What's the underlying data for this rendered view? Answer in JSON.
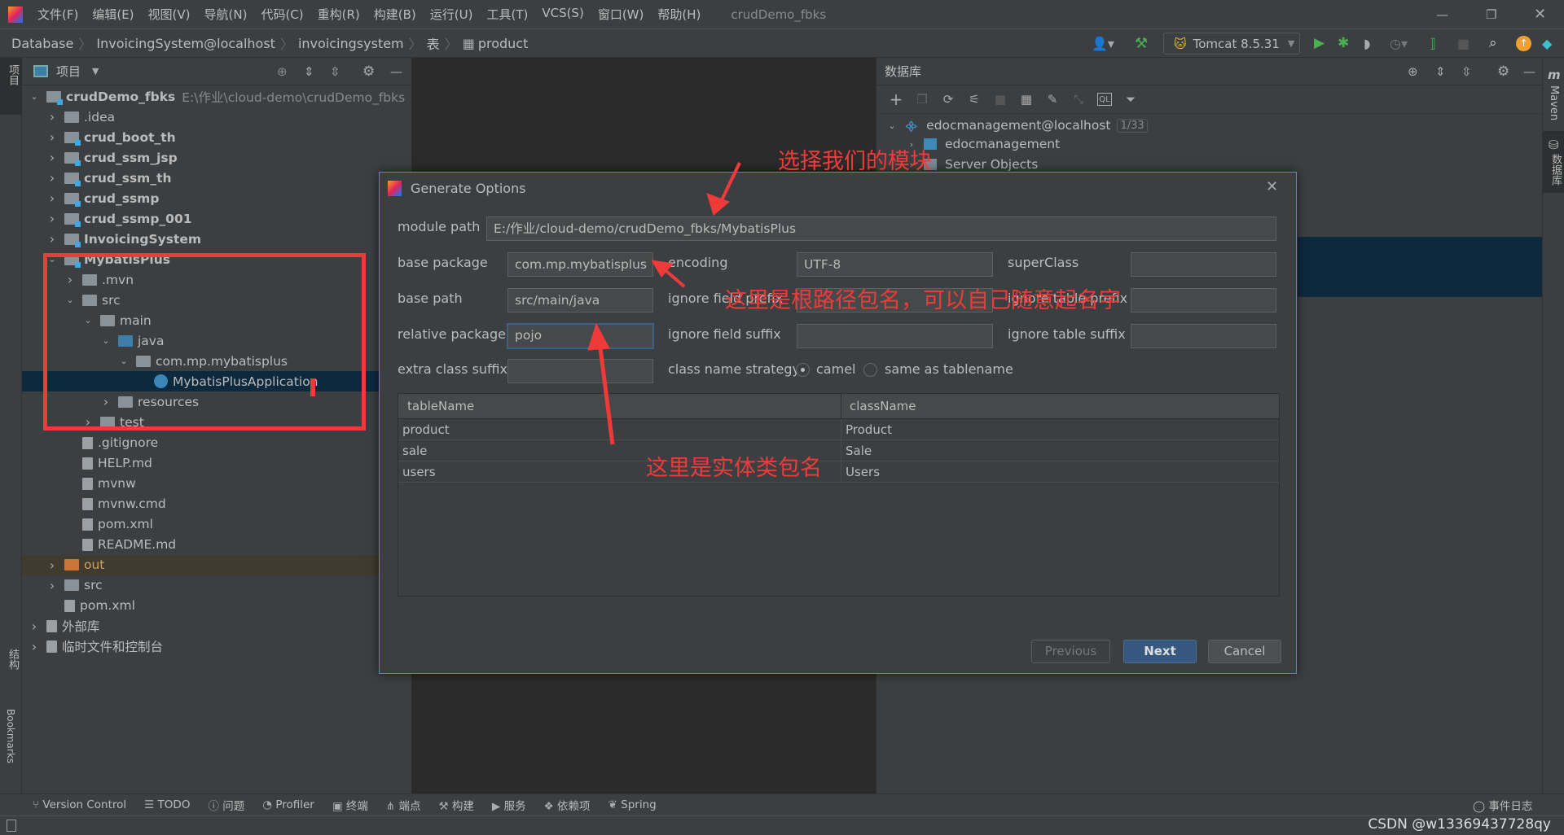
{
  "app": {
    "title": "crudDemo_fbks",
    "menu": [
      "文件(F)",
      "编辑(E)",
      "视图(V)",
      "导航(N)",
      "代码(C)",
      "重构(R)",
      "构建(B)",
      "运行(U)",
      "工具(T)",
      "VCS(S)",
      "窗口(W)",
      "帮助(H)"
    ]
  },
  "breadcrumb": [
    "Database",
    "InvoicingSystem@localhost",
    "invoicingsystem",
    "表",
    "product"
  ],
  "toolbar": {
    "run_config": "Tomcat 8.5.31"
  },
  "project": {
    "title": "项目",
    "tree": [
      {
        "level": 0,
        "chev": "open",
        "icon": "mod",
        "label": "crudDemo_fbks",
        "bold": true,
        "extra": "E:\\作业\\cloud-demo\\crudDemo_fbks"
      },
      {
        "level": 1,
        "chev": "closed",
        "icon": "folder",
        "label": ".idea"
      },
      {
        "level": 1,
        "chev": "closed",
        "icon": "mod",
        "label": "crud_boot_th",
        "bold": true
      },
      {
        "level": 1,
        "chev": "closed",
        "icon": "mod",
        "label": "crud_ssm_jsp",
        "bold": true
      },
      {
        "level": 1,
        "chev": "closed",
        "icon": "mod",
        "label": "crud_ssm_th",
        "bold": true
      },
      {
        "level": 1,
        "chev": "closed",
        "icon": "mod",
        "label": "crud_ssmp",
        "bold": true
      },
      {
        "level": 1,
        "chev": "closed",
        "icon": "mod",
        "label": "crud_ssmp_001",
        "bold": true
      },
      {
        "level": 1,
        "chev": "closed",
        "icon": "mod",
        "label": "InvoicingSystem",
        "bold": true
      },
      {
        "level": 1,
        "chev": "open",
        "icon": "mod",
        "label": "MybatisPlus",
        "bold": true
      },
      {
        "level": 2,
        "chev": "closed",
        "icon": "folder",
        "label": ".mvn"
      },
      {
        "level": 2,
        "chev": "open",
        "icon": "folder",
        "label": "src"
      },
      {
        "level": 3,
        "chev": "open",
        "icon": "folder",
        "label": "main"
      },
      {
        "level": 4,
        "chev": "open",
        "icon": "blue",
        "label": "java"
      },
      {
        "level": 5,
        "chev": "open",
        "icon": "folder",
        "label": "com.mp.mybatisplus"
      },
      {
        "level": 6,
        "chev": "none",
        "icon": "spring",
        "label": "MybatisPlusApplication",
        "selected": true
      },
      {
        "level": 4,
        "chev": "closed",
        "icon": "folder",
        "label": "resources"
      },
      {
        "level": 3,
        "chev": "closed",
        "icon": "folder",
        "label": "test"
      },
      {
        "level": 2,
        "chev": "none",
        "icon": "file",
        "label": ".gitignore"
      },
      {
        "level": 2,
        "chev": "none",
        "icon": "file",
        "label": "HELP.md"
      },
      {
        "level": 2,
        "chev": "none",
        "icon": "file",
        "label": "mvnw"
      },
      {
        "level": 2,
        "chev": "none",
        "icon": "file",
        "label": "mvnw.cmd"
      },
      {
        "level": 2,
        "chev": "none",
        "icon": "file",
        "label": "pom.xml"
      },
      {
        "level": 2,
        "chev": "none",
        "icon": "file",
        "label": "README.md"
      },
      {
        "level": 1,
        "chev": "closed",
        "icon": "orange",
        "label": "out",
        "tint": true
      },
      {
        "level": 1,
        "chev": "closed",
        "icon": "folder",
        "label": "src"
      },
      {
        "level": 1,
        "chev": "none",
        "icon": "file",
        "label": "pom.xml"
      },
      {
        "level": 0,
        "chev": "closed",
        "icon": "file",
        "label": "外部库"
      },
      {
        "level": 0,
        "chev": "closed",
        "icon": "file",
        "label": "临时文件和控制台"
      }
    ]
  },
  "database": {
    "title": "数据库",
    "connection": "edocmanagement@localhost",
    "badge": "1/33",
    "children": [
      "edocmanagement",
      "Server Objects"
    ]
  },
  "dialog": {
    "title": "Generate Options",
    "module_path_label": "module path",
    "module_path": "E:/作业/cloud-demo/crudDemo_fbks/MybatisPlus",
    "base_package_label": "base package",
    "base_package": "com.mp.mybatisplus",
    "encoding_label": "encoding",
    "encoding": "UTF-8",
    "superclass_label": "superClass",
    "superclass": "",
    "base_path_label": "base path",
    "base_path": "src/main/java",
    "ignore_field_prefix_label": "ignore field prefix",
    "ignore_table_prefix_label": "ignore table prefix",
    "relative_package_label": "relative package",
    "relative_package": "pojo",
    "ignore_field_suffix_label": "ignore field suffix",
    "ignore_table_suffix_label": "ignore table suffix",
    "extra_class_suffix_label": "extra class suffix",
    "class_name_strategy_label": "class name strategy",
    "strategy_options": [
      "camel",
      "same as tablename"
    ],
    "strategy_selected": "camel",
    "table": {
      "headers": [
        "tableName",
        "className"
      ],
      "rows": [
        [
          "product",
          "Product"
        ],
        [
          "sale",
          "Sale"
        ],
        [
          "users",
          "Users"
        ]
      ]
    },
    "buttons": {
      "previous": "Previous",
      "next": "Next",
      "cancel": "Cancel"
    }
  },
  "annotations": {
    "module": "选择我们的模块",
    "base_package": "这里是根路径包名，可以自己随意起名字",
    "relative_package": "这里是实体类包名",
    "color": "#f03a3a"
  },
  "left_stripe": {
    "project": "项目",
    "structure": "结构",
    "bookmarks": "Bookmarks"
  },
  "right_stripe": {
    "maven": "Maven",
    "database": "数据库"
  },
  "bottom_tools": [
    "Version Control",
    "TODO",
    "问题",
    "Profiler",
    "终端",
    "端点",
    "构建",
    "服务",
    "依赖项",
    "Spring"
  ],
  "event_log": "事件日志",
  "watermark": "CSDN @w13369437728qy"
}
